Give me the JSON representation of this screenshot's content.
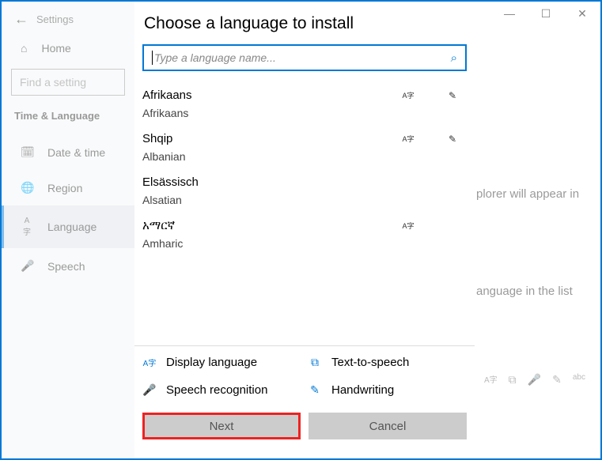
{
  "titlebar": {
    "app": "Settings",
    "minimize": "—",
    "maximize": "☐",
    "close": "✕",
    "back": "←"
  },
  "sidebar": {
    "home": "Home",
    "home_icon": "⌂",
    "search_placeholder": "Find a setting",
    "section": "Time & Language",
    "items": [
      {
        "icon": "🗓",
        "label": "Date & time"
      },
      {
        "icon": "🌐",
        "label": "Region"
      },
      {
        "icon": "A字",
        "label": "Language"
      },
      {
        "icon": "🎤",
        "label": "Speech"
      }
    ],
    "active_index": 2
  },
  "background": {
    "text1": "plorer will appear in",
    "text2": "anguage in the list",
    "icons": [
      "A字",
      "⧉",
      "🎤",
      "✎",
      "abc"
    ]
  },
  "dialog": {
    "title": "Choose a language to install",
    "search_placeholder": "Type a language name...",
    "search_icon": "⌕",
    "languages": [
      {
        "native": "Afrikaans",
        "english": "Afrikaans",
        "has_display": true,
        "has_handwriting": true
      },
      {
        "native": "Shqip",
        "english": "Albanian",
        "has_display": true,
        "has_handwriting": true
      },
      {
        "native": "Elsässisch",
        "english": "Alsatian",
        "has_display": false,
        "has_handwriting": false
      },
      {
        "native": "አማርኛ",
        "english": "Amharic",
        "has_display": true,
        "has_handwriting": false
      }
    ],
    "legend": {
      "display": "Display language",
      "tts": "Text-to-speech",
      "speech": "Speech recognition",
      "handwriting": "Handwriting"
    },
    "icons": {
      "display": "A字",
      "tts": "⧉",
      "speech": "🎤",
      "handwriting": "✎"
    },
    "buttons": {
      "next": "Next",
      "cancel": "Cancel"
    }
  }
}
